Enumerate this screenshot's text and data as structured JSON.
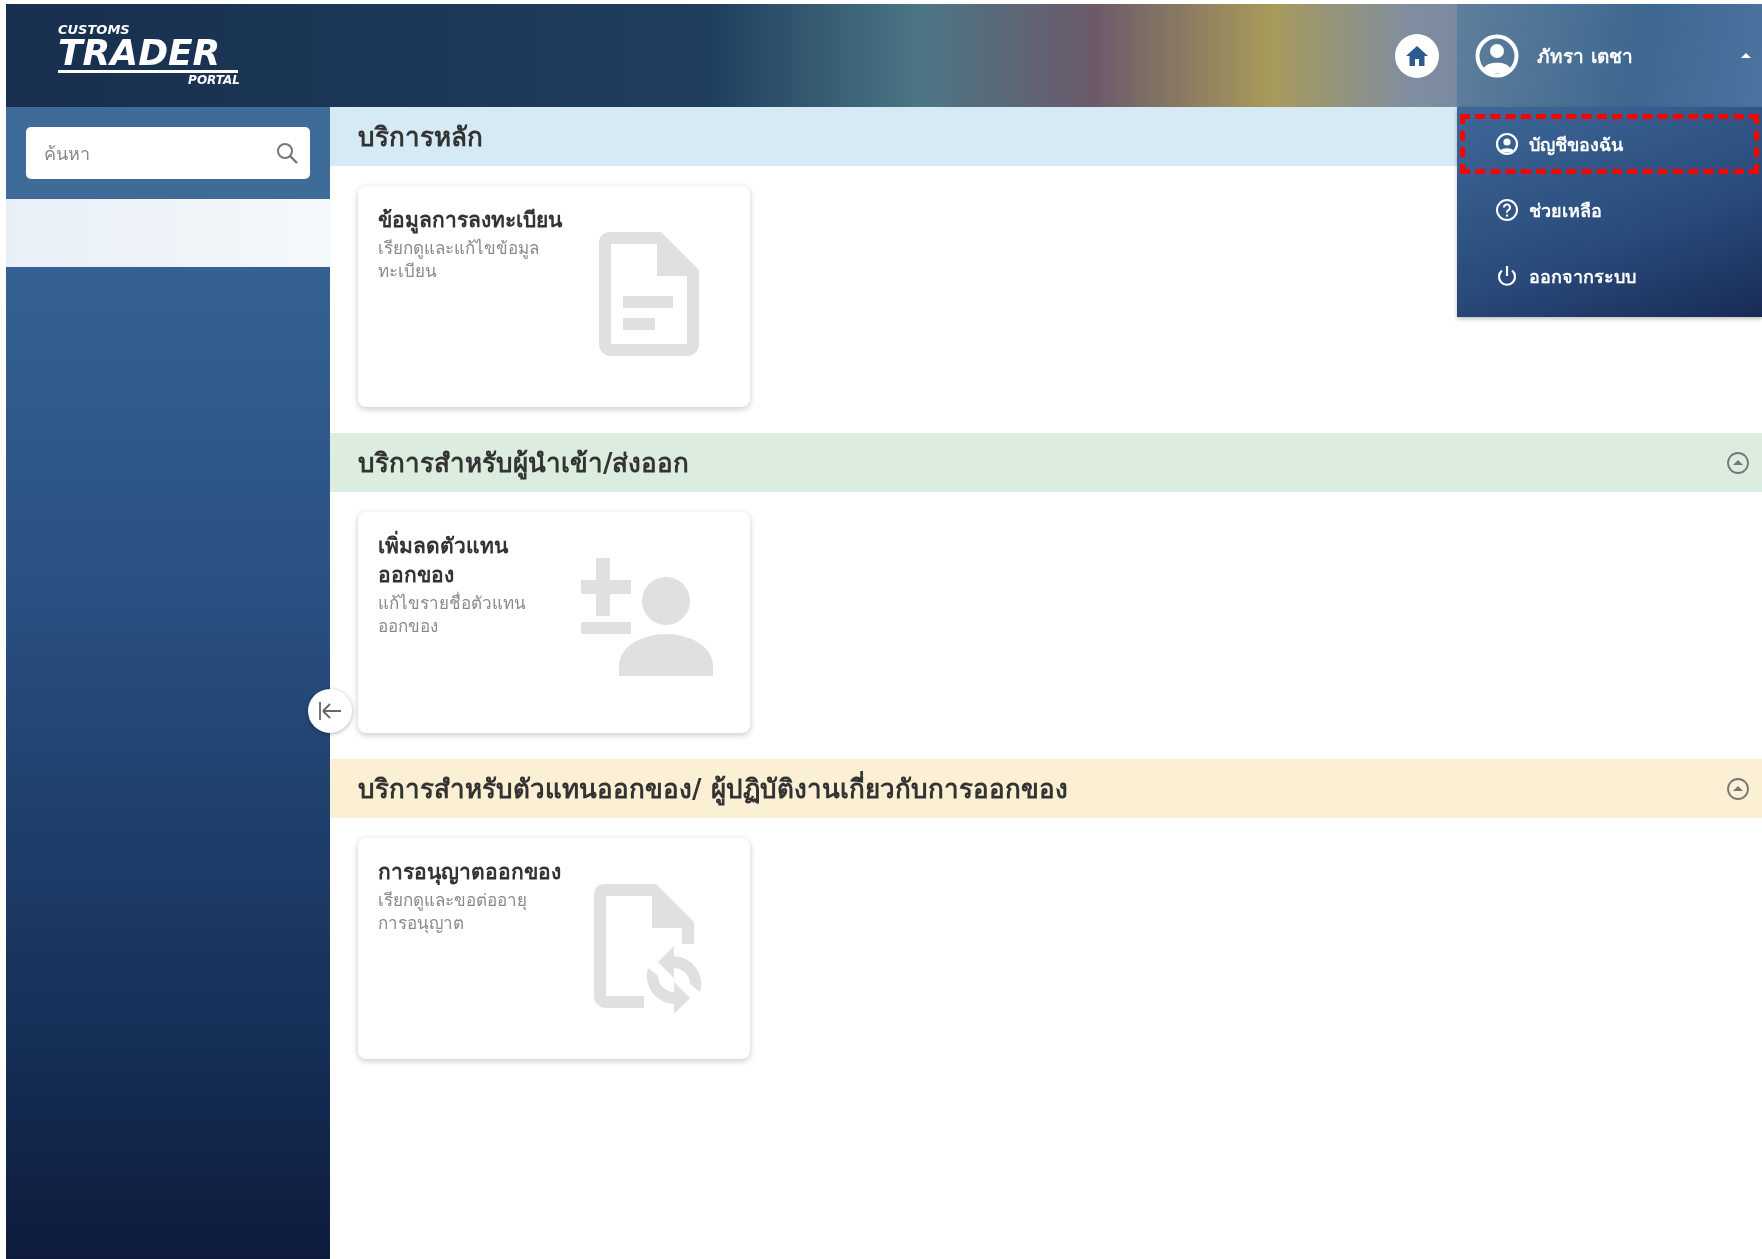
{
  "header": {
    "logo": {
      "top": "CUSTOMS",
      "main": "TRADER",
      "bottom": "PORTAL"
    },
    "user_name": "ภัทรา เตชา",
    "menu_expanded": true
  },
  "sidebar": {
    "search": {
      "placeholder": "ค้นหา"
    },
    "items": [
      {
        "selected": true
      }
    ]
  },
  "user_menu": [
    {
      "kind": "account",
      "label": "บัญชีของฉัน",
      "highlighted": true
    },
    {
      "kind": "help",
      "label": "ช่วยเหลือ",
      "highlighted": false
    },
    {
      "kind": "logout",
      "label": "ออกจากระบบ",
      "highlighted": false
    }
  ],
  "sections": [
    {
      "title": "บริการหลัก",
      "color": "#d5eaf5",
      "cards": [
        {
          "kind": "document",
          "title": "ข้อมูลการลงทะเบียน",
          "description": "เรียกดูและแก้ไขข้อมูล ทะเบียน"
        }
      ]
    },
    {
      "title": "บริการสำหรับผู้นำเข้า/ส่งออก",
      "color": "#dcede0",
      "expanded": true,
      "cards": [
        {
          "kind": "person-add-remove",
          "title": "เพิ่มลดตัวแทน ออกของ",
          "description": "แก้ไขรายชื่อตัวแทน ออกของ"
        }
      ]
    },
    {
      "title": "บริการสำหรับตัวแทนออกของ/ ผู้ปฏิบัติงานเกี่ยวกับการออกของ",
      "color": "#fbf0d4",
      "expanded": true,
      "cards": [
        {
          "kind": "document-sync",
          "title": "การอนุญาตออกของ",
          "description": "เรียกดูและขอต่ออายุ การอนุญาต"
        }
      ]
    }
  ]
}
